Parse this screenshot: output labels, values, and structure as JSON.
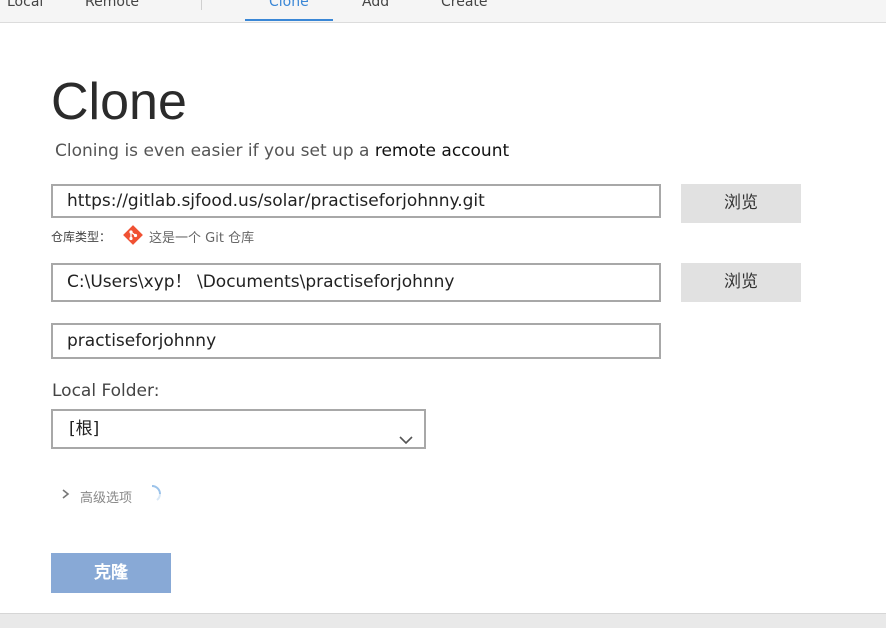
{
  "top_tabs": {
    "local": "Local",
    "remote": "Remote",
    "clone": "Clone",
    "add": "Add",
    "create": "Create"
  },
  "header": {
    "title": "Clone",
    "subtitle_prefix": "Cloning is even easier if you set up a",
    "subtitle_link": "remote account"
  },
  "form": {
    "source_url": "https://gitlab.sjfood.us/solar/practiseforjohnny.git",
    "browse_label": "浏览",
    "repo_type_label": "仓库类型：",
    "repo_type_value": "这是一个 Git 仓库",
    "destination_path": "C:\\Users\\xyp！ \\Documents\\practiseforjohnny",
    "name": "practiseforjohnny",
    "local_folder_label": "Local Folder:",
    "local_folder_value": "[根]",
    "advanced_label": "高级选项",
    "clone_button": "克隆"
  },
  "colors": {
    "accent": "#3a87d6",
    "clone_button_bg": "#88a9d6",
    "git_icon": "#f05133"
  },
  "icons": {
    "git": "git-icon",
    "dropdown": "chevron-down-icon",
    "advanced": "chevron-right-icon",
    "loading": "spinner-icon"
  }
}
